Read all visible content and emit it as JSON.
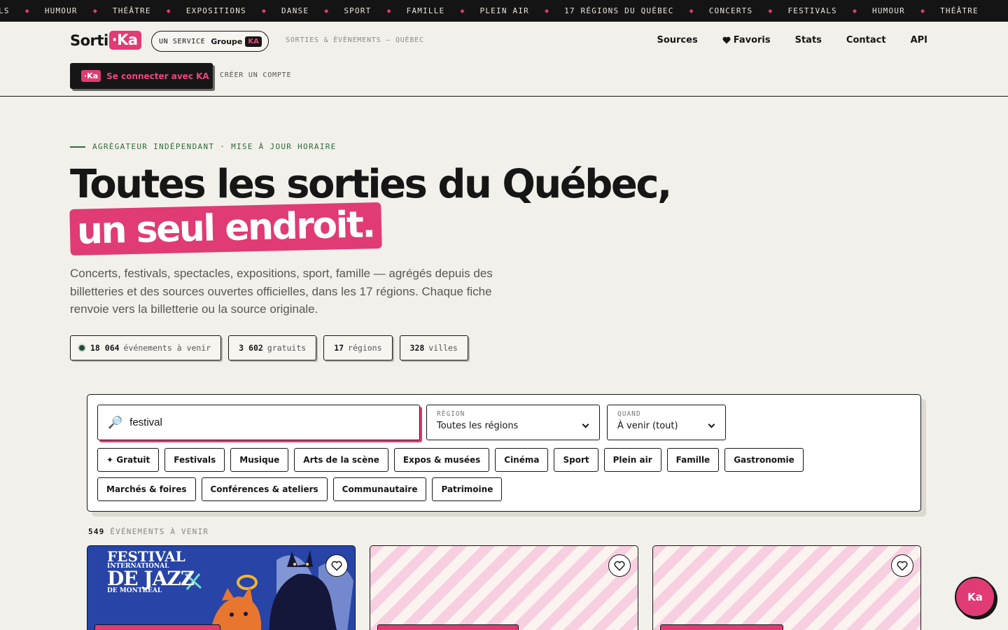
{
  "ticker": [
    "LS",
    "HUMOUR",
    "THÉÂTRE",
    "EXPOSITIONS",
    "DANSE",
    "SPORT",
    "FAMILLE",
    "PLEIN AIR",
    "17 RÉGIONS DU QUÉBEC",
    "CONCERTS",
    "FESTIVALS",
    "HUMOUR",
    "THÉÂTRE"
  ],
  "header": {
    "logo_text": "Sorti",
    "logo_ka": "·Ka",
    "service_label": "UN SERVICE",
    "service_brand": "Groupe",
    "service_badge": "KA",
    "tagline": "SORTIES & ÉVÉNEMENTS — QUÉBEC",
    "nav": {
      "sources": "Sources",
      "favoris": "Favoris",
      "stats": "Stats",
      "contact": "Contact",
      "api": "API"
    },
    "login_badge": "·Ka",
    "login_label": "Se connecter avec KA",
    "create_account": "CRÉER UN COMPTE"
  },
  "hero": {
    "eyebrow": "AGRÉGATEUR INDÉPENDANT · MISE À JOUR HORAIRE",
    "title_line1": "Toutes les sorties du Québec,",
    "title_line2": "un seul endroit.",
    "description": "Concerts, festivals, spectacles, expositions, sport, famille — agrégés depuis des billetteries et des sources ouvertes officielles, dans les 17 régions. Chaque fiche renvoie vers la billetterie ou la source originale."
  },
  "stats": [
    {
      "value": "18 064",
      "label": "événements à venir"
    },
    {
      "value": "3 602",
      "label": "gratuits"
    },
    {
      "value": "17",
      "label": "régions"
    },
    {
      "value": "328",
      "label": "villes"
    }
  ],
  "search": {
    "value": "festival",
    "region_label": "RÉGION",
    "region_value": "Toutes les régions",
    "when_label": "QUAND",
    "when_value": "À venir (tout)"
  },
  "chips": [
    "✦ Gratuit",
    "Festivals",
    "Musique",
    "Arts de la scène",
    "Expos & musées",
    "Cinéma",
    "Sport",
    "Plein air",
    "Famille",
    "Gastronomie",
    "Marchés & foires",
    "Conférences & ateliers",
    "Communautaire",
    "Patrimoine"
  ],
  "results": {
    "count": "549",
    "label": "ÉVÉNEMENTS À VENIR"
  },
  "poster": {
    "line1": "FESTIVAL",
    "line2": "INTERNATIONAL",
    "line3": "DE JAZZ",
    "line4": "DE MONTRÉAL"
  },
  "fab_label": "Ka",
  "colors": {
    "accent": "#e03b74",
    "ink": "#161616",
    "background": "#f2f0ea",
    "eyebrow": "#2f6b3d"
  }
}
